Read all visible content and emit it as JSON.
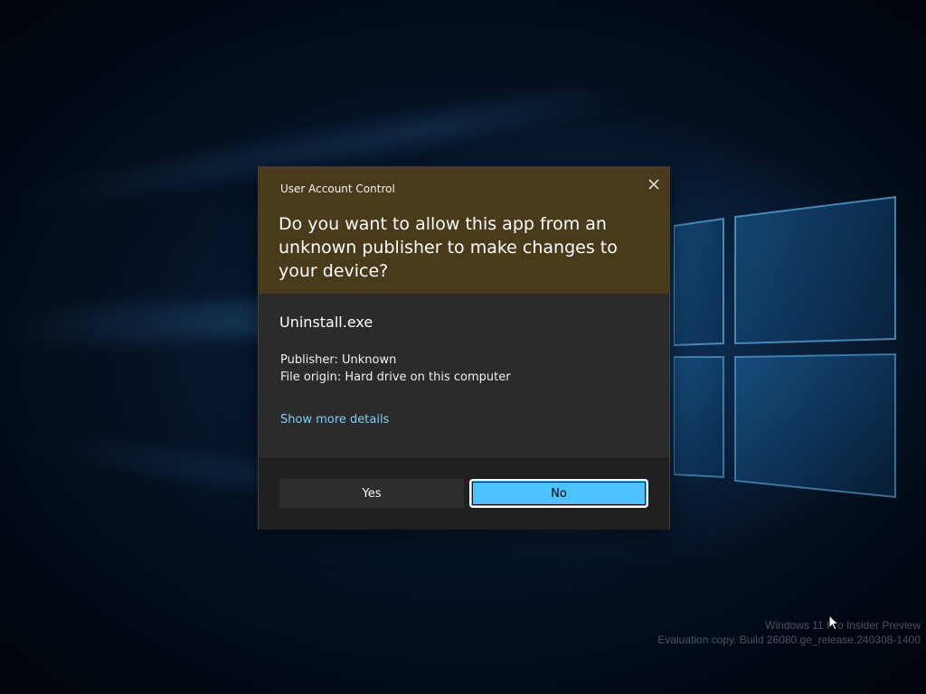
{
  "dialog": {
    "title": "User Account Control",
    "question": "Do you want to allow this app from an unknown publisher to make changes to your device?",
    "app_name": "Uninstall.exe",
    "publisher": "Publisher: Unknown",
    "file_origin": "File origin: Hard drive on this computer",
    "details_link": "Show more details",
    "yes_label": "Yes",
    "no_label": "No",
    "close_icon": "close-icon",
    "colors": {
      "header": "#4a3a1c",
      "body": "#2b2b2b",
      "footer": "#202020",
      "accent": "#4cc2ff",
      "link": "#7cd0f5"
    }
  },
  "desktop": {
    "watermark_line1": "Windows 11 Pro Insider Preview",
    "watermark_line2": "Evaluation copy. Build 26080.ge_release.240308-1400"
  }
}
